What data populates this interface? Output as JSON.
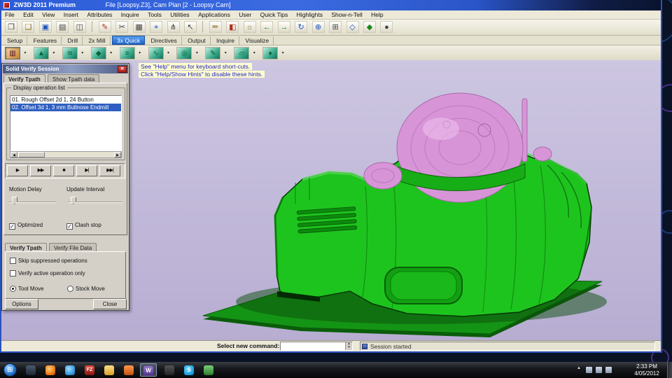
{
  "titlebar": {
    "app": "ZW3D 2011 Premium",
    "doc": "File [Loopsy.Z3],  Cam Plan [2 - Loopsy Cam]"
  },
  "menus": [
    "File",
    "Edit",
    "View",
    "Insert",
    "Attributes",
    "Inquire",
    "Tools",
    "Utilities",
    "Applications",
    "User",
    "Quick Tips",
    "Highlights",
    "Show-n-Tell",
    "Help"
  ],
  "toolbar_icons": [
    {
      "name": "new-file-icon",
      "glyph": "❐"
    },
    {
      "name": "open-file-icon",
      "glyph": "❑"
    },
    {
      "name": "save-icon",
      "glyph": "▣"
    },
    {
      "name": "print-icon",
      "glyph": "▤"
    },
    {
      "name": "print-preview-icon",
      "glyph": "◫"
    },
    {
      "name": "pen-icon",
      "glyph": "✎"
    },
    {
      "name": "trim-icon",
      "glyph": "✂"
    },
    {
      "name": "grid-icon",
      "glyph": "▦"
    },
    {
      "name": "target-icon",
      "glyph": "⌖"
    },
    {
      "name": "filter-icon",
      "glyph": "⋔"
    },
    {
      "name": "pick-arrow-icon",
      "glyph": "↖"
    },
    {
      "name": "pencil-icon",
      "glyph": "✏"
    },
    {
      "name": "shade-mode-icon",
      "glyph": "◧"
    },
    {
      "name": "light-icon",
      "glyph": "☼"
    },
    {
      "name": "view-back-icon",
      "glyph": "←"
    },
    {
      "name": "view-forward-icon",
      "glyph": "→"
    },
    {
      "name": "regen-icon",
      "glyph": "↻"
    },
    {
      "name": "zoom-all-icon",
      "glyph": "⊕"
    },
    {
      "name": "zoom-window-icon",
      "glyph": "⊞"
    },
    {
      "name": "iso-view-icon",
      "glyph": "◇"
    },
    {
      "name": "render-mode-icon",
      "glyph": "◆"
    },
    {
      "name": "sphere-view-icon",
      "glyph": "●"
    }
  ],
  "ribbon_tabs": [
    "Setup",
    "Features",
    "Drill",
    "2x Mill",
    "3x Quick",
    "Directives",
    "Output",
    "Inquire",
    "Visualize"
  ],
  "cam_icons": [
    {
      "name": "solid-verify-icon",
      "glyph": "▥"
    },
    {
      "name": "cam-plan-icon",
      "glyph": "▲"
    },
    {
      "name": "rough-offset-icon",
      "glyph": "≋"
    },
    {
      "name": "offset-3d-icon",
      "glyph": "◆"
    },
    {
      "name": "lace-icon",
      "glyph": "≡"
    },
    {
      "name": "zigzag-icon",
      "glyph": "∿"
    },
    {
      "name": "spiral-icon",
      "glyph": "◎"
    },
    {
      "name": "pencil-cut-icon",
      "glyph": "✎"
    },
    {
      "name": "flat-finish-icon",
      "glyph": "▱"
    },
    {
      "name": "drill-op-icon",
      "glyph": "♦"
    }
  ],
  "hints": {
    "line1": "See \"Help\" menu for keyboard short-cuts.",
    "line2": "Click \"Help/Show Hints\" to disable these hints."
  },
  "dialog": {
    "title": "Solid Verify Session",
    "tabs_top": [
      "Verify Tpath",
      "Show Tpath data"
    ],
    "group_label": "Display operation list",
    "operations": [
      "01. Rough Offset 2d 1, 24 Button",
      "02. Offset 3d 1, 3 mm Bullnose Endmill"
    ],
    "selected_operation": "02. Offset 3d 1, 3 mm Bullnose Endmill",
    "playback": [
      "▶",
      "▶▶",
      "■",
      "▶|",
      "▶▶|"
    ],
    "motion_delay_label": "Motion Delay",
    "update_interval_label": "Update Interval",
    "checkbox_optimized": "Optimized",
    "checkbox_clash": "Clash stop",
    "tabs_bottom": [
      "Verify Tpath",
      "Verify File Data"
    ],
    "checkbox_skip": "Skip suppressed operations",
    "checkbox_active_only": "Verify active operation only",
    "radio_tool_move": "Tool Move",
    "radio_stock_move": "Stock Move",
    "options_button": "Options",
    "close_button": "Close"
  },
  "command_bar": {
    "label": "Select new command:",
    "input_value": "",
    "status": "Session started"
  },
  "taskbar": {
    "time": "2:33 PM",
    "date": "4/05/2012",
    "icons": [
      {
        "name": "taskbar-app-dark-icon",
        "label": ""
      },
      {
        "name": "taskbar-firefox-icon",
        "label": ""
      },
      {
        "name": "taskbar-browser-globe-icon",
        "label": ""
      },
      {
        "name": "taskbar-filezilla-icon",
        "label": "FZ"
      },
      {
        "name": "taskbar-explorer-icon",
        "label": ""
      },
      {
        "name": "taskbar-media-icon",
        "label": ""
      },
      {
        "name": "taskbar-zw3d-icon",
        "label": "W"
      },
      {
        "name": "taskbar-app2-icon",
        "label": ""
      },
      {
        "name": "taskbar-skype-icon",
        "label": "S"
      },
      {
        "name": "taskbar-app3-icon",
        "label": ""
      }
    ]
  },
  "ui_glyphs": {
    "dropdown": "▾",
    "check": "✓",
    "close": "✕",
    "spin_up": "▴",
    "spin_down": "▾",
    "left": "◀",
    "right": "▶",
    "tray_up": "▲",
    "start": "⊞"
  },
  "colors": {
    "viewport_top": "#cdc6e1",
    "viewport_bottom": "#b7add2",
    "model_green": "#1ec41e",
    "model_pink": "#d795d8",
    "tab_active": "#1f63c8",
    "highlight": "#2f5fc0"
  }
}
